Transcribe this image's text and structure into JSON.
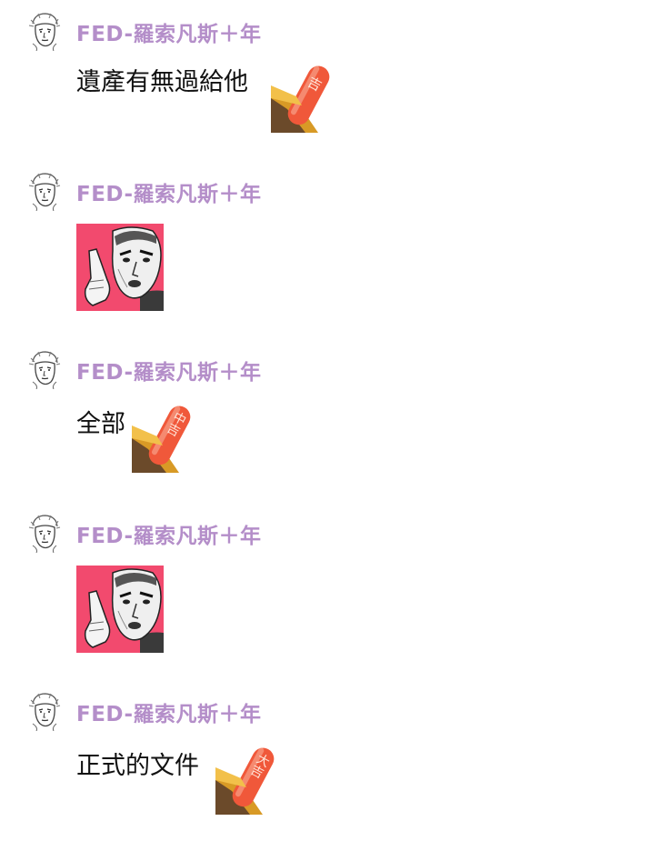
{
  "messages": [
    {
      "author": "FED-羅索凡斯＋年",
      "text": "遺產有無過給他",
      "sticker": {
        "type": "fortune-stick",
        "label": "吉"
      }
    },
    {
      "author": "FED-羅索凡斯＋年",
      "sticker": {
        "type": "pointing-man-meme"
      }
    },
    {
      "author": "FED-羅索凡斯＋年",
      "text": "全部",
      "sticker": {
        "type": "fortune-stick",
        "label": "中吉"
      }
    },
    {
      "author": "FED-羅索凡斯＋年",
      "sticker": {
        "type": "pointing-man-meme"
      }
    },
    {
      "author": "FED-羅索凡斯＋年",
      "text": "正式的文件",
      "sticker": {
        "type": "fortune-stick",
        "label": "大吉"
      }
    }
  ],
  "colors": {
    "author": "#b48ec9",
    "text": "#111111",
    "stick_red": "#f0583a",
    "stick_tube": "#e0a228",
    "meme_bg": "#f24a6e"
  }
}
